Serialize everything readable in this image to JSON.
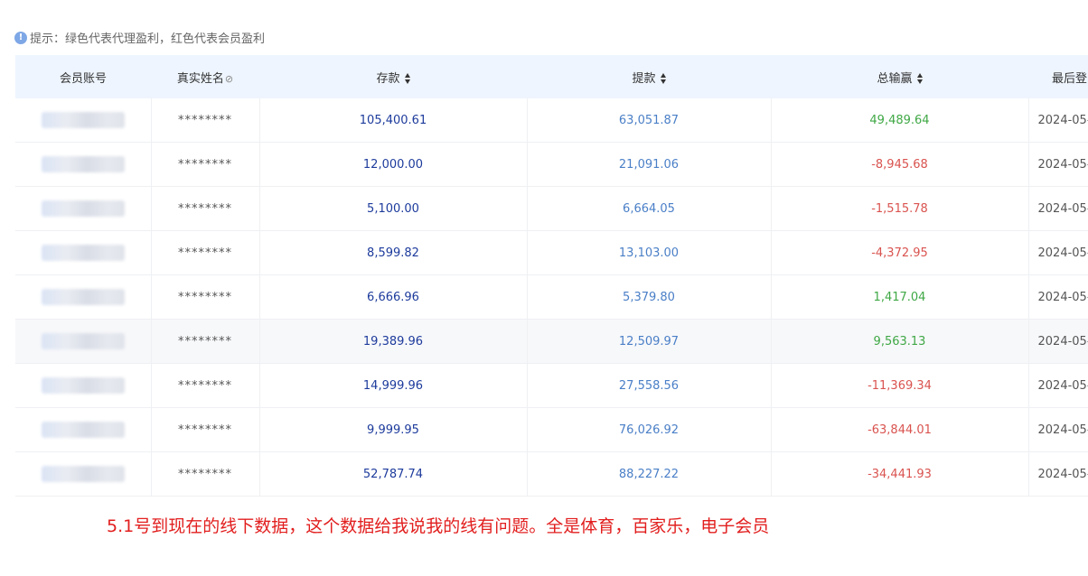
{
  "hint": {
    "icon": "info-icon",
    "text": "提示：绿色代表代理盈利，红色代表会员盈利"
  },
  "table": {
    "headers": {
      "account": "会员账号",
      "name": "真实姓名",
      "deposit": "存款",
      "withdraw": "提款",
      "winloss": "总输赢",
      "last": "最后登"
    },
    "rows": [
      {
        "name": "********",
        "deposit": "105,400.61",
        "withdraw": "63,051.87",
        "winloss": "49,489.64",
        "sign": "pos",
        "last": "2024-05-"
      },
      {
        "name": "********",
        "deposit": "12,000.00",
        "withdraw": "21,091.06",
        "winloss": "-8,945.68",
        "sign": "neg",
        "last": "2024-05-"
      },
      {
        "name": "********",
        "deposit": "5,100.00",
        "withdraw": "6,664.05",
        "winloss": "-1,515.78",
        "sign": "neg",
        "last": "2024-05-"
      },
      {
        "name": "********",
        "deposit": "8,599.82",
        "withdraw": "13,103.00",
        "winloss": "-4,372.95",
        "sign": "neg",
        "last": "2024-05-"
      },
      {
        "name": "********",
        "deposit": "6,666.96",
        "withdraw": "5,379.80",
        "winloss": "1,417.04",
        "sign": "pos",
        "last": "2024-05-"
      },
      {
        "name": "********",
        "deposit": "19,389.96",
        "withdraw": "12,509.97",
        "winloss": "9,563.13",
        "sign": "pos",
        "last": "2024-05-"
      },
      {
        "name": "********",
        "deposit": "14,999.96",
        "withdraw": "27,558.56",
        "winloss": "-11,369.34",
        "sign": "neg",
        "last": "2024-05-"
      },
      {
        "name": "********",
        "deposit": "9,999.95",
        "withdraw": "76,026.92",
        "winloss": "-63,844.01",
        "sign": "neg",
        "last": "2024-05-"
      },
      {
        "name": "********",
        "deposit": "52,787.74",
        "withdraw": "88,227.22",
        "winloss": "-34,441.93",
        "sign": "neg",
        "last": "2024-05-"
      }
    ]
  },
  "note": "5.1号到现在的线下数据，这个数据给我说我的线有问题。全是体育，百家乐，电子会员",
  "colors": {
    "header_bg": "#eef5fe",
    "deposit": "#1d3b9c",
    "withdraw": "#4a7fc7",
    "positive": "#3fa845",
    "negative": "#d9534f",
    "note": "#e21e1e"
  }
}
